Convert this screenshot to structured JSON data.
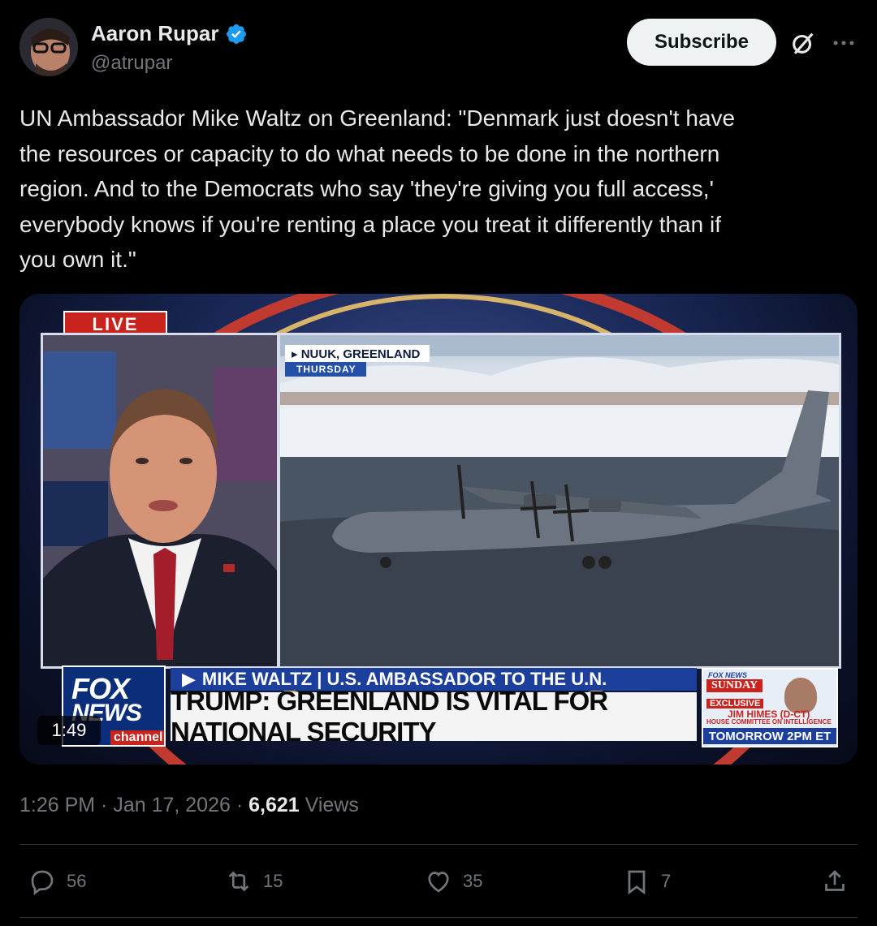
{
  "author": {
    "name": "Aaron Rupar",
    "handle": "@atrupar",
    "verified": true
  },
  "header": {
    "subscribe_label": "Subscribe",
    "icons": [
      "grok-icon",
      "more-icon"
    ]
  },
  "tweet": {
    "text": "UN Ambassador Mike Waltz on Greenland: \"Denmark just doesn't have\nthe resources or capacity to do what needs to be done in the northern\nregion. And to the Democrats who say 'they're giving you full access,'\neverybody knows if you're renting a place you treat it differently than if\nyou own it.\""
  },
  "video": {
    "live_label": "LIVE",
    "location": "NUUK, GREENLAND",
    "day": "THURSDAY",
    "network_top": "FOX",
    "network_mid": "NEWS",
    "network_bottom": "channel",
    "name_bar": "MIKE WALTZ | U.S. AMBASSADOR TO THE U.N.",
    "headline": "TRUMP: GREENLAND IS VITAL FOR NATIONAL SECURITY",
    "promo": {
      "network": "FOX NEWS",
      "show": "SUNDAY",
      "tag": "EXCLUSIVE",
      "guest": "JIM HIMES (D-CT)",
      "committee": "HOUSE COMMITTEE ON INTELLIGENCE",
      "time": "TOMORROW 2PM ET"
    },
    "duration": "1:49"
  },
  "meta": {
    "timestamp": "1:26 PM · Jan 17, 2026 · ",
    "views_count": "6,621",
    "views_label": " Views"
  },
  "actions": {
    "replies": "56",
    "reposts": "15",
    "likes": "35",
    "bookmarks": "7"
  },
  "colors": {
    "background": "#000000",
    "text": "#e7e9ea",
    "muted": "#71767b",
    "verified": "#1d9bf0",
    "fox_red": "#c8231d",
    "fox_blue": "#1d3f9c"
  }
}
